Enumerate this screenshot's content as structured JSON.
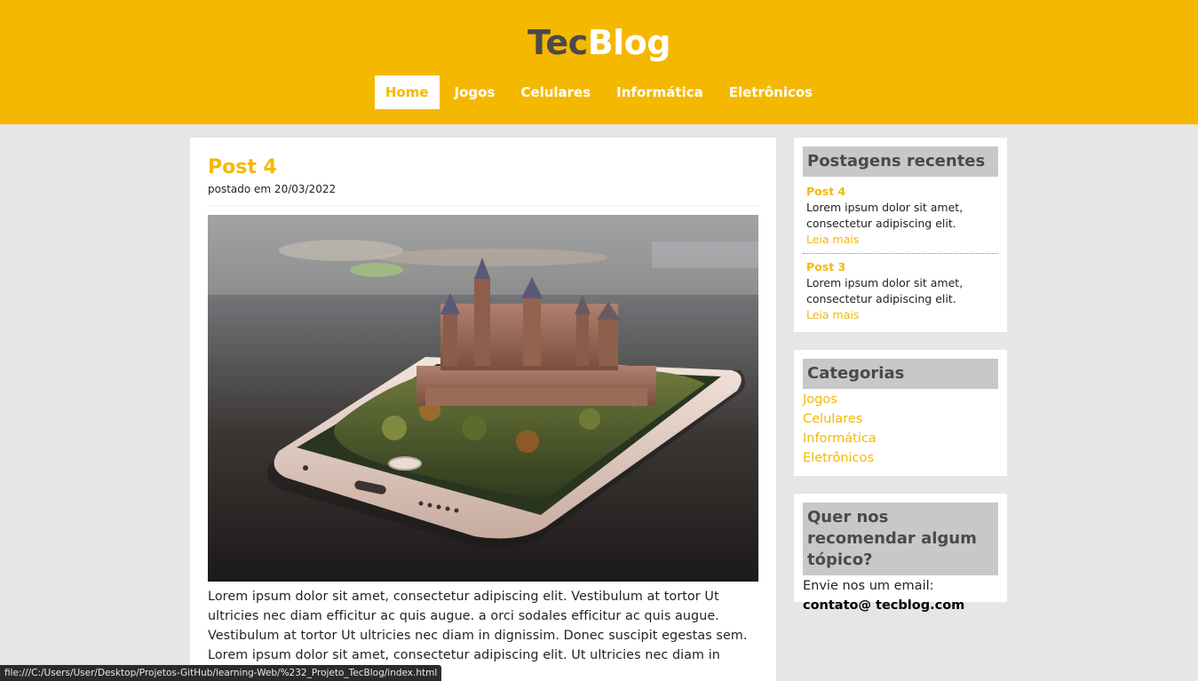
{
  "header": {
    "logo_part1": "Tec",
    "logo_part2": "Blog",
    "nav": [
      "Home",
      "Jogos",
      "Celulares",
      "Informática",
      "Eletrônicos"
    ],
    "active_index": 0
  },
  "post": {
    "title": "Post 4",
    "date": "postado em 20/03/2022",
    "text": "Lorem ipsum dolor sit amet, consectetur adipiscing elit. Vestibulum at tortor Ut ultricies nec diam efficitur ac quis augue. a orci sodales efficitur ac quis augue. Vestibulum at tortor Ut ultricies nec diam in dignissim. Donec suscipit egestas sem. Lorem ipsum dolor sit amet, consectetur adipiscing elit. Ut ultricies nec diam in"
  },
  "sidebar": {
    "recent": {
      "title": "Postagens recentes",
      "items": [
        {
          "title": "Post 4",
          "text": "Lorem ipsum dolor sit amet, consectetur adipiscing elit.",
          "more": "Leia mais"
        },
        {
          "title": "Post 3",
          "text": "Lorem ipsum dolor sit amet, consectetur adipiscing elit.",
          "more": "Leia mais"
        }
      ]
    },
    "categories": {
      "title": "Categorias",
      "items": [
        "Jogos",
        "Celulares",
        "Informática",
        "Eletrônicos"
      ]
    },
    "recommend": {
      "title": "Quer nos recomendar algum tópico?",
      "text": "Envie nos um email:",
      "email": "contato@ tecblog.com"
    }
  },
  "statusbar": "file:///C:/Users/User/Desktop/Projetos-GitHub/learning-Web/%232_Projeto_TecBlog/index.html",
  "colors": {
    "accent": "#f5b800",
    "widget_title_bg": "#c8c8c8",
    "page_bg": "#e6e6e6"
  }
}
